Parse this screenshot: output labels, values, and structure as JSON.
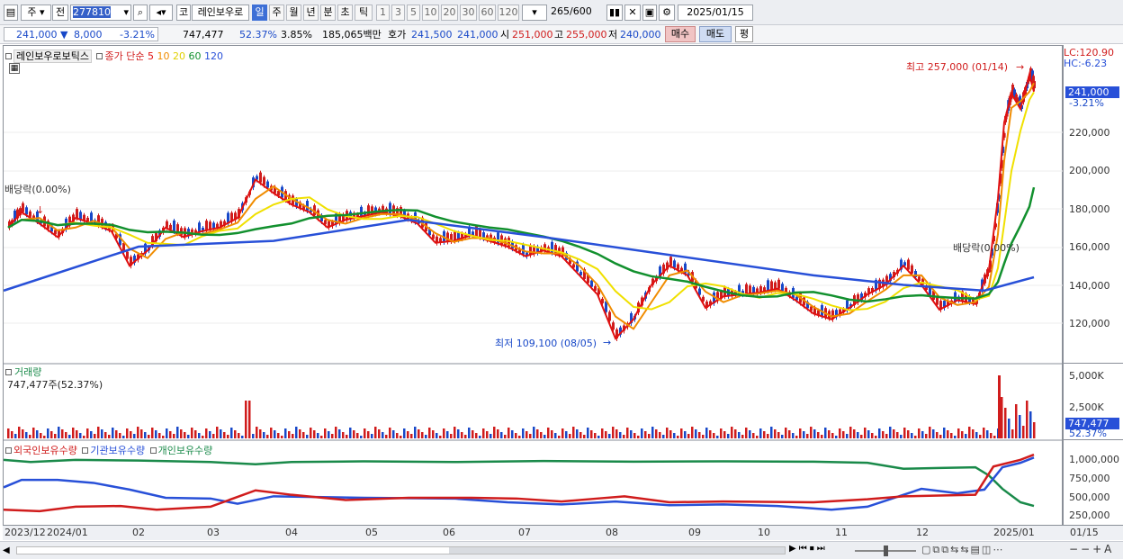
{
  "toolbar": {
    "mode_label": "주",
    "prev_label": "전",
    "code_value": "277810",
    "market_label": "코",
    "stock_name": "레인보우로",
    "periods": [
      "일",
      "주",
      "월",
      "년",
      "분",
      "초",
      "틱"
    ],
    "active_period": "일",
    "intervals": [
      "1",
      "3",
      "5",
      "10",
      "20",
      "30",
      "60",
      "120"
    ],
    "count_value": "265",
    "count_total": "/600",
    "date_value": "2025/01/15"
  },
  "quote": {
    "price": "241,000",
    "change": "8,000",
    "change_pct": "-3.21%",
    "volume": "747,477",
    "volume_pct": "52.37%",
    "turnover_pct": "3.85%",
    "amount": "185,065백만",
    "bid_label": "호가",
    "bid": "241,500",
    "ask": "241,000",
    "open_label": "시",
    "open": "251,000",
    "high_label": "고",
    "high": "255,000",
    "low_label": "저",
    "low": "240,000",
    "buy_label": "매수",
    "sell_label": "매도",
    "eval_label": "평"
  },
  "price_panel": {
    "stock_label": "레인보우로보틱스",
    "ma_label": "종가 단순",
    "ma_periods": [
      "5",
      "10",
      "20",
      "60",
      "120"
    ],
    "lc_label": "LC:120.90",
    "hc_label": "HC:-6.23",
    "high_annotation": "최고 257,000 (01/14)",
    "low_annotation": "최저 109,100 (08/05)",
    "dividend_label_1": "배당락(0.00%)",
    "dividend_label_2": "배당락(0.00%)",
    "current_price": "241,000",
    "current_pct": "-3.21%",
    "y_ticks": [
      "220,000",
      "200,000",
      "180,000",
      "160,000",
      "140,000",
      "120,000"
    ]
  },
  "volume_panel": {
    "title": "거래량",
    "info": "747,477주(52.37%)",
    "y_ticks": [
      "5,000K",
      "2,500K"
    ],
    "current": "747,477",
    "current_pct": "52.37%"
  },
  "holdings_panel": {
    "series_labels": [
      "외국인보유수량",
      "기관보유수량",
      "개인보유수량"
    ],
    "y_ticks": [
      "1,000,000",
      "750,000",
      "500,000",
      "250,000"
    ]
  },
  "x_axis": [
    "2023/12",
    "2024/01",
    "02",
    "03",
    "04",
    "05",
    "06",
    "07",
    "08",
    "09",
    "10",
    "11",
    "12",
    "2025/01",
    "01/15"
  ],
  "colors": {
    "up": "#d01c1c",
    "down": "#1848c8",
    "ma5": "#e01010",
    "ma10": "#f08c00",
    "ma20": "#f0e000",
    "ma60": "#12902e",
    "ma120": "#2850d8",
    "foreign": "#d01c1c",
    "institution": "#2850d8",
    "individual": "#1a8a4a"
  }
}
